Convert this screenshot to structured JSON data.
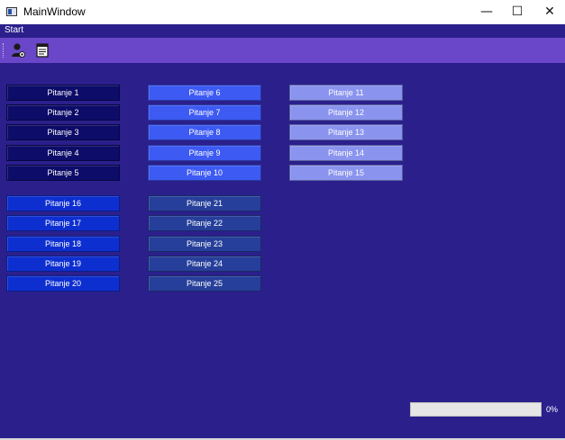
{
  "window": {
    "title": "MainWindow",
    "minimize_glyph": "—",
    "maximize_glyph": "☐",
    "close_glyph": "✕"
  },
  "menubar": {
    "items": [
      "Start"
    ]
  },
  "toolbar": {
    "icons": [
      "user-icon",
      "notepad-icon"
    ]
  },
  "colors": {
    "background": "#2b1f8c",
    "toolbar": "#6a47c9",
    "group1": "#0d0c68",
    "group2": "#3d5af3",
    "group3": "#8a94ee",
    "group4": "#0e2fd0",
    "group5": "#263f9a"
  },
  "questions": [
    "Pitanje 1",
    "Pitanje 2",
    "Pitanje 3",
    "Pitanje 4",
    "Pitanje 5",
    "Pitanje 6",
    "Pitanje 7",
    "Pitanje 8",
    "Pitanje 9",
    "Pitanje 10",
    "Pitanje 11",
    "Pitanje 12",
    "Pitanje 13",
    "Pitanje 14",
    "Pitanje 15",
    "Pitanje 16",
    "Pitanje 17",
    "Pitanje 18",
    "Pitanje 19",
    "Pitanje 20",
    "Pitanje 21",
    "Pitanje 22",
    "Pitanje 23",
    "Pitanje 24",
    "Pitanje 25"
  ],
  "progress": {
    "value": 0,
    "label": "0%"
  }
}
